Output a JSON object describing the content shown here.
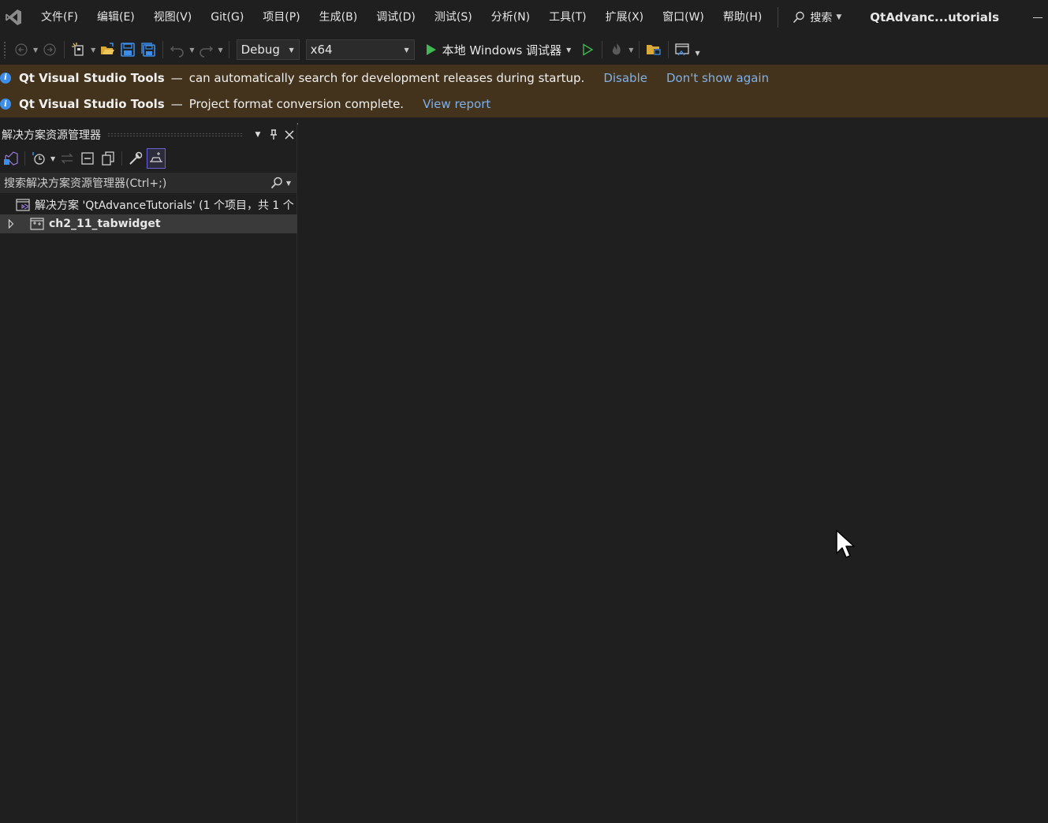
{
  "menubar": {
    "items": [
      "文件(F)",
      "编辑(E)",
      "视图(V)",
      "Git(G)",
      "项目(P)",
      "生成(B)",
      "调试(D)",
      "测试(S)",
      "分析(N)",
      "工具(T)",
      "扩展(X)",
      "窗口(W)",
      "帮助(H)"
    ],
    "search_label": "搜索",
    "window_title": "QtAdvanc...utorials"
  },
  "toolbar": {
    "configuration": "Debug",
    "platform": "x64",
    "run_label": "本地 Windows 调试器"
  },
  "infobars": [
    {
      "source": "Qt Visual Studio Tools",
      "dash": "—",
      "message": "can automatically search for development releases during startup.",
      "links": [
        "Disable",
        "Don't show again"
      ]
    },
    {
      "source": "Qt Visual Studio Tools",
      "dash": "—",
      "message": "Project format conversion complete.",
      "links": [
        "View report"
      ]
    }
  ],
  "solution_explorer": {
    "title": "解决方案资源管理器",
    "search_placeholder": "搜索解决方案资源管理器(Ctrl+;)",
    "solution_label": "解决方案 'QtAdvanceTutorials' (1 个项目，共 1 个",
    "project_label": "ch2_11_tabwidget"
  },
  "colors": {
    "background": "#1f1f1f",
    "infobar": "#43331c",
    "link": "#7fb0ea",
    "accent": "#7a6ae0",
    "run_green": "#3fb950",
    "vs_purple": "#9a80e0"
  }
}
